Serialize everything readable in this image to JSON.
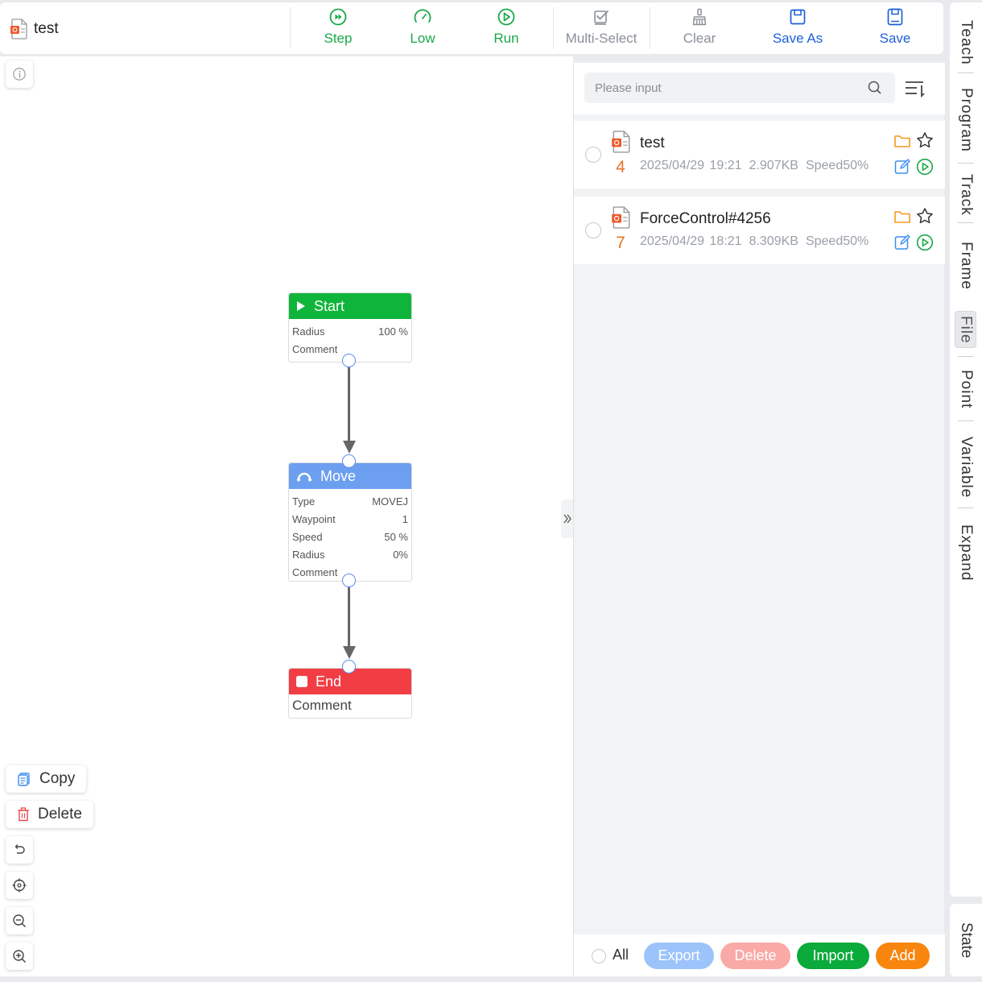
{
  "window": {
    "file_name": "test"
  },
  "toolbar": {
    "step": "Step",
    "low": "Low",
    "run": "Run",
    "multi_select": "Multi-Select",
    "clear": "Clear",
    "save_as": "Save As",
    "save": "Save"
  },
  "canvas_tools": {
    "copy": "Copy",
    "delete": "Delete"
  },
  "flow": {
    "start": {
      "title": "Start",
      "rows": [
        {
          "k": "Radius",
          "v": "100 %"
        },
        {
          "k": "Comment",
          "v": ""
        }
      ]
    },
    "move": {
      "title": "Move",
      "rows": [
        {
          "k": "Type",
          "v": "MOVEJ"
        },
        {
          "k": "Waypoint",
          "v": "1"
        },
        {
          "k": "Speed",
          "v": "50 %"
        },
        {
          "k": "Radius",
          "v": "0%"
        },
        {
          "k": "Comment",
          "v": ""
        }
      ]
    },
    "end": {
      "title": "End",
      "comment": "Comment"
    }
  },
  "panel": {
    "search_placeholder": "Please input",
    "files": [
      {
        "name": "test",
        "num": "4",
        "date": "2025/04/29 19:21",
        "size": "2.907KB",
        "speed": "Speed50%"
      },
      {
        "name": "ForceControl#4256",
        "num": "7",
        "date": "2025/04/29 18:21",
        "size": "8.309KB",
        "speed": "Speed50%"
      }
    ],
    "bottom": {
      "all": "All",
      "export": "Export",
      "delete": "Delete",
      "import": "Import",
      "add": "Add"
    }
  },
  "tabs": [
    "Teach",
    "Program",
    "Track",
    "Frame",
    "File",
    "Point",
    "Variable",
    "Expand"
  ],
  "active_tab": "File",
  "state_tab": "State",
  "colors": {
    "start": "#0fb53b",
    "move": "#6c9ff0",
    "end": "#f23d44",
    "export": "#9cc4fb",
    "delete": "#f9aaa6",
    "import": "#0aaa3b",
    "add": "#f8850e",
    "toolbar_green": "#1aa84a",
    "toolbar_blue": "#1e5fd9"
  }
}
